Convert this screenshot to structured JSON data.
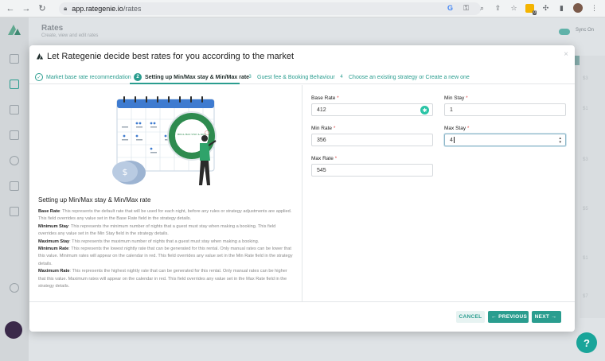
{
  "browser": {
    "url_host": "app.rategenie.io",
    "url_path": "/rates",
    "extension_badge": "0"
  },
  "app": {
    "page_title": "Rates",
    "page_subtitle": "Create, view and edit rates",
    "sync_label": "Sync On",
    "help_label": "?"
  },
  "modal": {
    "title": "Let Rategenie decide best rates for you according to the market",
    "close_label": "×",
    "steps": [
      {
        "number": "✓",
        "label": "Market base rate recommendation",
        "state": "done"
      },
      {
        "number": "2",
        "label": "Setting up Min/Max stay & Min/Max rate",
        "state": "active"
      },
      {
        "number": "3",
        "label": "Guest fee & Booking Behaviour",
        "state": "todo"
      },
      {
        "number": "4",
        "label": "Choose an existing strategy or Create a new one",
        "state": "todo"
      }
    ],
    "illustration_text": "MIN & MAX STAY & RATE",
    "section_title": "Setting up Min/Max stay & Min/Max rate",
    "descriptions": [
      {
        "term": "Base Rate",
        "text": ": This represents the default rate that will be used for each night, before any rules or strategy adjustments are applied. This field overrides any value set in the Base Rate field in the strategy details."
      },
      {
        "term": "Minimum Stay",
        "text": ": This represents the minimum number of nights that a guest must stay when making a booking. This field overrides any value set in the Min Stay field in the strategy details."
      },
      {
        "term": "Maximum Stay",
        "text": ": This represents the maximum number of nights that a guest must stay when making a booking."
      },
      {
        "term": "Minimum Rate",
        "text": ": This represents the lowest nightly rate that can be generated for this rental. Only manual rates can be lower that this value. Minimum rates will appear on the calendar in red. This field overrides any value set in the Min Rate field in the strategy details."
      },
      {
        "term": "Maximum Rate",
        "text": ": This represents the highest nightly rate that can be generated for this rental. Only manual rates can be higher that this value. Maximum rates will appear on the calendar in red. This field overrides any value set in the Max Rate field in the strategy details."
      }
    ],
    "fields": {
      "base_rate": {
        "label": "Base Rate",
        "value": "412"
      },
      "min_stay": {
        "label": "Min Stay",
        "value": "1"
      },
      "min_rate": {
        "label": "Min Rate",
        "value": "356"
      },
      "max_stay": {
        "label": "Max Stay",
        "value": "4"
      },
      "max_rate": {
        "label": "Max Rate",
        "value": "545"
      }
    },
    "required_mark": "*",
    "buttons": {
      "cancel": "CANCEL",
      "previous": "PREVIOUS",
      "next": "NEXT"
    }
  },
  "colors": {
    "accent": "#2a9d8f",
    "required": "#e05252",
    "calendar_blue": "#3e7bd0"
  }
}
